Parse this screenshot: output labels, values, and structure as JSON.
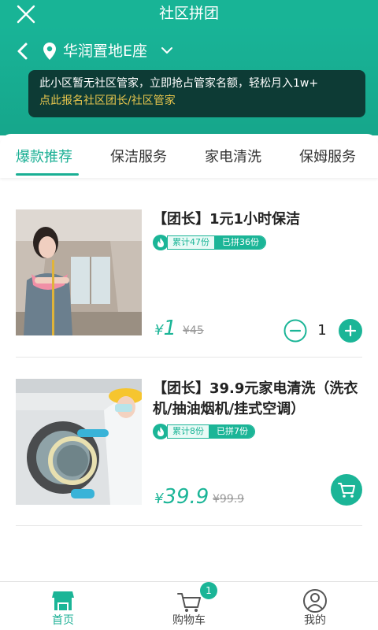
{
  "app": {
    "title": "社区拼团",
    "location": "华润置地E座"
  },
  "notice": {
    "line1": "此小区暂无社区管家，立即抢占管家名额，轻松月入1w+",
    "line2": "点此报名社区团长/社区管家"
  },
  "tabs": [
    {
      "label": "爆款推荐",
      "active": true
    },
    {
      "label": "保洁服务",
      "active": false
    },
    {
      "label": "家电清洗",
      "active": false
    },
    {
      "label": "保姆服务",
      "active": false
    }
  ],
  "products": [
    {
      "title": "【团长】1元1小时保洁",
      "stat_total": "累计47份",
      "stat_joined": "已拼36份",
      "currency": "¥",
      "price": "1",
      "old_price": "¥45",
      "quantity": "1"
    },
    {
      "title": "【团长】39.9元家电清洗（洗衣机/抽油烟机/挂式空调）",
      "stat_total": "累计8份",
      "stat_joined": "已拼7份",
      "currency": "¥",
      "price": "39.9",
      "old_price": "¥99.9"
    }
  ],
  "bottom_nav": [
    {
      "label": "首页",
      "icon": "store-icon",
      "active": true
    },
    {
      "label": "购物车",
      "icon": "cart-icon",
      "active": false,
      "badge": "1"
    },
    {
      "label": "我的",
      "icon": "user-icon",
      "active": false
    }
  ],
  "colors": {
    "accent": "#1bb597",
    "header": "#18b496",
    "notice_bg": "#0d3b35",
    "notice_link": "#e8c64d"
  }
}
